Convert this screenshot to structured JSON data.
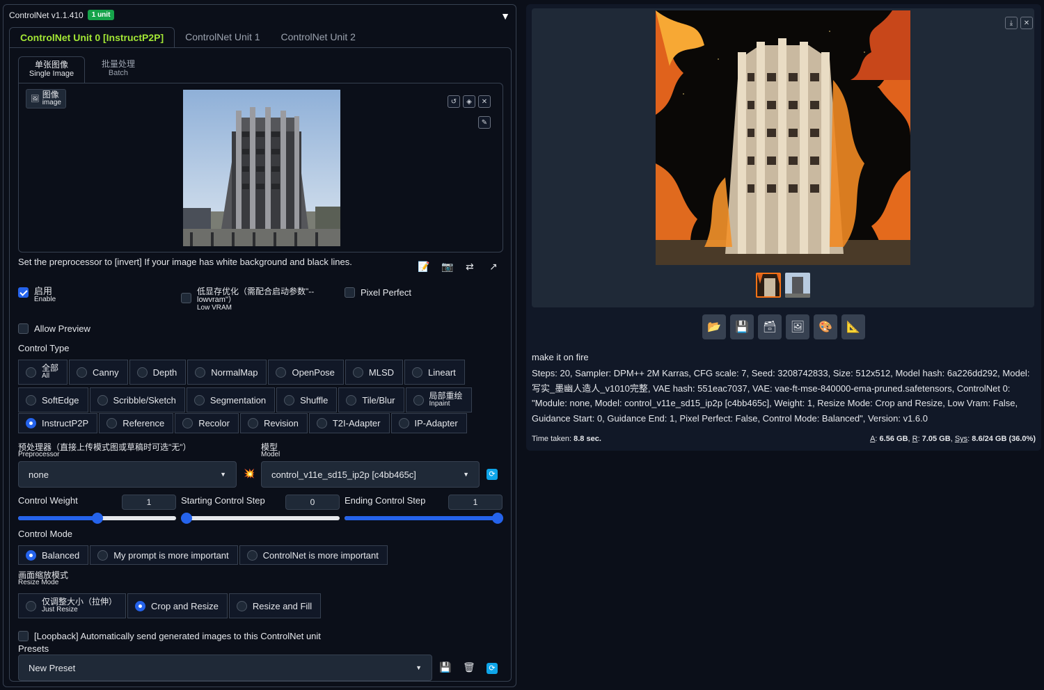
{
  "header": {
    "title": "ControlNet v1.1.410",
    "badge": "1 unit"
  },
  "unit_tabs": [
    "ControlNet Unit 0 [InstructP2P]",
    "ControlNet Unit 1",
    "ControlNet Unit 2"
  ],
  "mode_tabs": [
    {
      "zh": "单张图像",
      "en": "Single Image"
    },
    {
      "zh": "批量处理",
      "en": "Batch"
    }
  ],
  "image_label": {
    "zh": "图像",
    "en": "image"
  },
  "hint": "Set the preprocessor to [invert] If your image has white background and black lines.",
  "checks": {
    "enable": {
      "zh": "启用",
      "en": "Enable",
      "checked": true
    },
    "low_vram": {
      "zh": "低显存优化（需配合启动参数\"--",
      "zh2": "lowvram\"）",
      "en": "Low VRAM",
      "checked": false
    },
    "pixel_perfect": {
      "label": "Pixel Perfect",
      "checked": false
    },
    "allow_preview": {
      "label": "Allow Preview",
      "checked": false
    }
  },
  "control_type": {
    "label": "Control Type",
    "row1": [
      "Canny",
      "Depth",
      "NormalMap",
      "OpenPose",
      "MLSD",
      "Lineart"
    ],
    "all": {
      "zh": "全部",
      "en": "All"
    },
    "row2": [
      "SoftEdge",
      "Scribble/Sketch",
      "Segmentation",
      "Shuffle",
      "Tile/Blur"
    ],
    "inpaint": {
      "zh": "局部重绘",
      "en": "Inpaint"
    },
    "row3": [
      "InstructP2P",
      "Reference",
      "Recolor",
      "Revision",
      "T2I-Adapter",
      "IP-Adapter"
    ],
    "selected": "InstructP2P"
  },
  "preprocessor": {
    "zh": "预处理器（直接上传模式图或草稿时可选\"无\"）",
    "en": "Preprocessor",
    "value": "none"
  },
  "model": {
    "zh": "模型",
    "en": "Model",
    "value": "control_v11e_sd15_ip2p [c4bb465c]"
  },
  "sliders": {
    "weight": {
      "label": "Control Weight",
      "value": "1",
      "fraction": 0.5
    },
    "start": {
      "label": "Starting Control Step",
      "value": "0",
      "fraction": 0
    },
    "end": {
      "label": "Ending Control Step",
      "value": "1",
      "fraction": 1
    }
  },
  "control_mode": {
    "label": "Control Mode",
    "options": [
      "Balanced",
      "My prompt is more important",
      "ControlNet is more important"
    ],
    "selected": "Balanced"
  },
  "resize_mode": {
    "zh": "画面缩放模式",
    "en": "Resize Mode",
    "just_resize": {
      "zh": "仅调整大小（拉伸）",
      "en": "Just Resize"
    },
    "options": [
      "Crop and Resize",
      "Resize and Fill"
    ],
    "selected": "Crop and Resize"
  },
  "loopback": "[Loopback] Automatically send generated images to this ControlNet unit",
  "presets": {
    "label": "Presets",
    "value": "New Preset"
  },
  "output": {
    "prompt": "make it on fire",
    "info": "Steps: 20, Sampler: DPM++ 2M Karras, CFG scale: 7, Seed: 3208742833, Size: 512x512, Model hash: 6a226dd292, Model: 写实_墨幽人造人_v1010完整, VAE hash: 551eac7037, VAE: vae-ft-mse-840000-ema-pruned.safetensors, ControlNet 0: \"Module: none, Model: control_v11e_sd15_ip2p [c4bb465c], Weight: 1, Resize Mode: Crop and Resize, Low Vram: False, Guidance Start: 0, Guidance End: 1, Pixel Perfect: False, Control Mode: Balanced\", Version: v1.6.0",
    "time_label": "Time taken:",
    "time_value": "8.8 sec.",
    "mem_a_label": "A",
    "mem_a": "6.56 GB",
    "mem_r_label": "R",
    "mem_r": "7.05 GB",
    "mem_sys_label": "Sys",
    "mem_sys": "8.6/24 GB (36.0%)"
  }
}
